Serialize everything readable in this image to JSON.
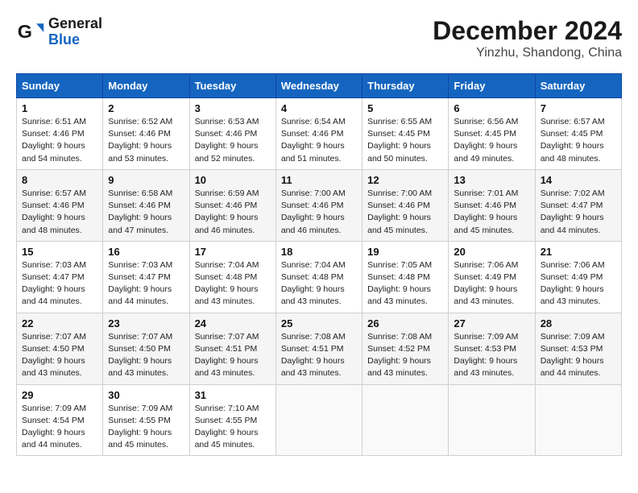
{
  "header": {
    "logo": {
      "general": "General",
      "blue": "Blue"
    },
    "title": "December 2024",
    "subtitle": "Yinzhu, Shandong, China"
  },
  "days_of_week": [
    "Sunday",
    "Monday",
    "Tuesday",
    "Wednesday",
    "Thursday",
    "Friday",
    "Saturday"
  ],
  "weeks": [
    [
      {
        "day": 1,
        "sunrise": "6:51 AM",
        "sunset": "4:46 PM",
        "daylight": "9 hours and 54 minutes."
      },
      {
        "day": 2,
        "sunrise": "6:52 AM",
        "sunset": "4:46 PM",
        "daylight": "9 hours and 53 minutes."
      },
      {
        "day": 3,
        "sunrise": "6:53 AM",
        "sunset": "4:46 PM",
        "daylight": "9 hours and 52 minutes."
      },
      {
        "day": 4,
        "sunrise": "6:54 AM",
        "sunset": "4:46 PM",
        "daylight": "9 hours and 51 minutes."
      },
      {
        "day": 5,
        "sunrise": "6:55 AM",
        "sunset": "4:45 PM",
        "daylight": "9 hours and 50 minutes."
      },
      {
        "day": 6,
        "sunrise": "6:56 AM",
        "sunset": "4:45 PM",
        "daylight": "9 hours and 49 minutes."
      },
      {
        "day": 7,
        "sunrise": "6:57 AM",
        "sunset": "4:45 PM",
        "daylight": "9 hours and 48 minutes."
      }
    ],
    [
      {
        "day": 8,
        "sunrise": "6:57 AM",
        "sunset": "4:46 PM",
        "daylight": "9 hours and 48 minutes."
      },
      {
        "day": 9,
        "sunrise": "6:58 AM",
        "sunset": "4:46 PM",
        "daylight": "9 hours and 47 minutes."
      },
      {
        "day": 10,
        "sunrise": "6:59 AM",
        "sunset": "4:46 PM",
        "daylight": "9 hours and 46 minutes."
      },
      {
        "day": 11,
        "sunrise": "7:00 AM",
        "sunset": "4:46 PM",
        "daylight": "9 hours and 46 minutes."
      },
      {
        "day": 12,
        "sunrise": "7:00 AM",
        "sunset": "4:46 PM",
        "daylight": "9 hours and 45 minutes."
      },
      {
        "day": 13,
        "sunrise": "7:01 AM",
        "sunset": "4:46 PM",
        "daylight": "9 hours and 45 minutes."
      },
      {
        "day": 14,
        "sunrise": "7:02 AM",
        "sunset": "4:47 PM",
        "daylight": "9 hours and 44 minutes."
      }
    ],
    [
      {
        "day": 15,
        "sunrise": "7:03 AM",
        "sunset": "4:47 PM",
        "daylight": "9 hours and 44 minutes."
      },
      {
        "day": 16,
        "sunrise": "7:03 AM",
        "sunset": "4:47 PM",
        "daylight": "9 hours and 44 minutes."
      },
      {
        "day": 17,
        "sunrise": "7:04 AM",
        "sunset": "4:48 PM",
        "daylight": "9 hours and 43 minutes."
      },
      {
        "day": 18,
        "sunrise": "7:04 AM",
        "sunset": "4:48 PM",
        "daylight": "9 hours and 43 minutes."
      },
      {
        "day": 19,
        "sunrise": "7:05 AM",
        "sunset": "4:48 PM",
        "daylight": "9 hours and 43 minutes."
      },
      {
        "day": 20,
        "sunrise": "7:06 AM",
        "sunset": "4:49 PM",
        "daylight": "9 hours and 43 minutes."
      },
      {
        "day": 21,
        "sunrise": "7:06 AM",
        "sunset": "4:49 PM",
        "daylight": "9 hours and 43 minutes."
      }
    ],
    [
      {
        "day": 22,
        "sunrise": "7:07 AM",
        "sunset": "4:50 PM",
        "daylight": "9 hours and 43 minutes."
      },
      {
        "day": 23,
        "sunrise": "7:07 AM",
        "sunset": "4:50 PM",
        "daylight": "9 hours and 43 minutes."
      },
      {
        "day": 24,
        "sunrise": "7:07 AM",
        "sunset": "4:51 PM",
        "daylight": "9 hours and 43 minutes."
      },
      {
        "day": 25,
        "sunrise": "7:08 AM",
        "sunset": "4:51 PM",
        "daylight": "9 hours and 43 minutes."
      },
      {
        "day": 26,
        "sunrise": "7:08 AM",
        "sunset": "4:52 PM",
        "daylight": "9 hours and 43 minutes."
      },
      {
        "day": 27,
        "sunrise": "7:09 AM",
        "sunset": "4:53 PM",
        "daylight": "9 hours and 43 minutes."
      },
      {
        "day": 28,
        "sunrise": "7:09 AM",
        "sunset": "4:53 PM",
        "daylight": "9 hours and 44 minutes."
      }
    ],
    [
      {
        "day": 29,
        "sunrise": "7:09 AM",
        "sunset": "4:54 PM",
        "daylight": "9 hours and 44 minutes."
      },
      {
        "day": 30,
        "sunrise": "7:09 AM",
        "sunset": "4:55 PM",
        "daylight": "9 hours and 45 minutes."
      },
      {
        "day": 31,
        "sunrise": "7:10 AM",
        "sunset": "4:55 PM",
        "daylight": "9 hours and 45 minutes."
      },
      null,
      null,
      null,
      null
    ]
  ]
}
